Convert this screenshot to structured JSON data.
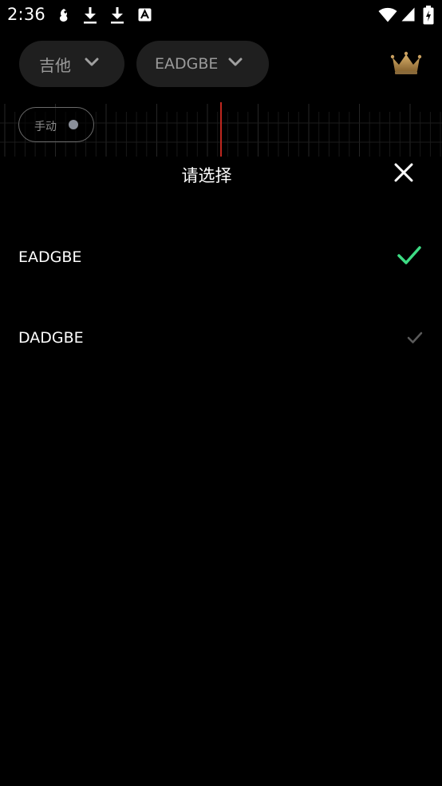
{
  "status_bar": {
    "time": "2:36",
    "left_icons": [
      "notification-app-icon",
      "download-icon",
      "download-icon",
      "font-app-icon"
    ],
    "right_icons": [
      "wifi-icon",
      "cellular-signal-icon",
      "battery-charging-icon"
    ]
  },
  "header": {
    "instrument_label": "吉他",
    "tuning_label": "EADGBE",
    "premium_icon": "crown-icon",
    "colors": {
      "pill_bg": "#1f1f1f",
      "pill_text": "#9a9a9a",
      "crown": "#b08a4a"
    }
  },
  "meter": {
    "mode_label": "手动",
    "needle_color": "#c0271f"
  },
  "picker": {
    "title": "请选择",
    "close_icon": "close-icon",
    "options": [
      {
        "label": "EADGBE",
        "selected": true
      },
      {
        "label": "DADGBE",
        "selected": false
      }
    ],
    "colors": {
      "check_selected": "#3ddc84",
      "check_unselected": "#5a5a5a"
    }
  }
}
